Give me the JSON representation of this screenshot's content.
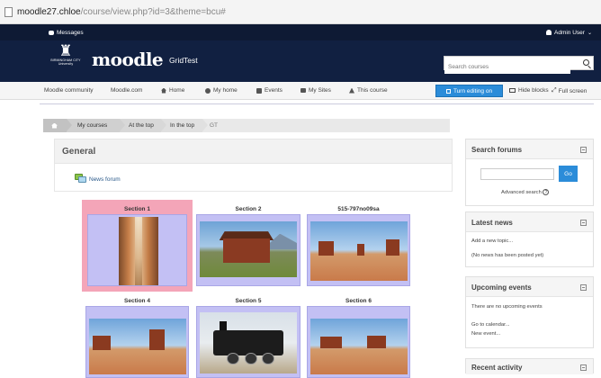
{
  "browser": {
    "url_host": "moodle27.chloe",
    "url_path": "/course/view.php?id=3&theme=bcu#"
  },
  "topbar": {
    "messages": "Messages",
    "user": "Admin User"
  },
  "header": {
    "university_line1": "BIRMINGHAM CITY",
    "university_line2": "University",
    "moodle_logo": "moodle",
    "site_name": "GridTest",
    "search_placeholder": "Search courses"
  },
  "nav": {
    "items": [
      {
        "label": "Moodle community",
        "icon": ""
      },
      {
        "label": "Moodle.com",
        "icon": ""
      },
      {
        "label": "Home",
        "icon": "home-icon"
      },
      {
        "label": "My home",
        "icon": "dashboard-icon"
      },
      {
        "label": "Events",
        "icon": "calendar-icon"
      },
      {
        "label": "My Sites",
        "icon": "sites-icon"
      },
      {
        "label": "This course",
        "icon": "sitemap-icon"
      }
    ],
    "edit_button": "Turn editing on",
    "hide_blocks": "Hide blocks",
    "full_screen": "Full screen"
  },
  "breadcrumb": [
    "My courses",
    "At the top",
    "In the top",
    "GT"
  ],
  "course": {
    "general_title": "General",
    "forum_label": "News forum"
  },
  "sections": [
    {
      "title": "Section 1",
      "image": "canyon",
      "active": true
    },
    {
      "title": "Section 2",
      "image": "house",
      "active": false
    },
    {
      "title": "515-797no09sa",
      "image": "desert",
      "active": false
    },
    {
      "title": "Section 4",
      "image": "desert",
      "active": false
    },
    {
      "title": "Section 5",
      "image": "train",
      "active": false
    },
    {
      "title": "Section 6",
      "image": "desert",
      "active": false
    }
  ],
  "blocks": {
    "search_forums": {
      "title": "Search forums",
      "go": "Go",
      "advanced": "Advanced search",
      "help": "?"
    },
    "latest_news": {
      "title": "Latest news",
      "add": "Add a new topic...",
      "empty": "(No news has been posted yet)"
    },
    "upcoming_events": {
      "title": "Upcoming events",
      "none": "There are no upcoming events",
      "calendar": "Go to calendar...",
      "new_event": "New event..."
    },
    "recent_activity": {
      "title": "Recent activity"
    }
  },
  "colors": {
    "header_bg": "#112041",
    "topbar_bg": "#0e1a34",
    "accent": "#2b8cd9",
    "tile_bg": "#c3c0f4",
    "tile_active": "#f4a5b8"
  }
}
